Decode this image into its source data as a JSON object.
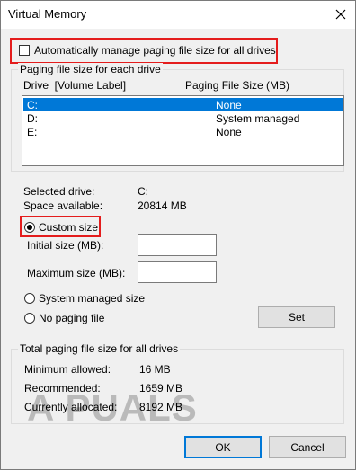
{
  "window": {
    "title": "Virtual Memory",
    "close_icon": "close-icon"
  },
  "auto_manage": {
    "label": "Automatically manage paging file size for all drives",
    "checked": false
  },
  "per_drive": {
    "group_label": "Paging file size for each drive",
    "col_drive": "Drive  [Volume Label]",
    "col_size": "Paging File Size (MB)",
    "drives": [
      {
        "drive": "C:",
        "size": "None"
      },
      {
        "drive": "D:",
        "size": "System managed"
      },
      {
        "drive": "E:",
        "size": "None"
      }
    ],
    "selected_index": 0
  },
  "selected": {
    "drive_label": "Selected drive:",
    "drive_value": "C:",
    "space_label": "Space available:",
    "space_value": "20814 MB"
  },
  "options": {
    "custom_size": "Custom size:",
    "initial_label": "Initial size (MB):",
    "initial_value": "",
    "maximum_label": "Maximum size (MB):",
    "maximum_value": "",
    "system_managed": "System managed size",
    "no_paging": "No paging file",
    "set_button": "Set",
    "selected_option": "custom"
  },
  "totals": {
    "group_label": "Total paging file size for all drives",
    "min_label": "Minimum allowed:",
    "min_value": "16 MB",
    "rec_label": "Recommended:",
    "rec_value": "1659 MB",
    "cur_label": "Currently allocated:",
    "cur_value": "8192 MB"
  },
  "buttons": {
    "ok": "OK",
    "cancel": "Cancel"
  },
  "watermark": "A PUALS",
  "colors": {
    "highlight": "#e41c1c",
    "selection": "#0078d7"
  }
}
